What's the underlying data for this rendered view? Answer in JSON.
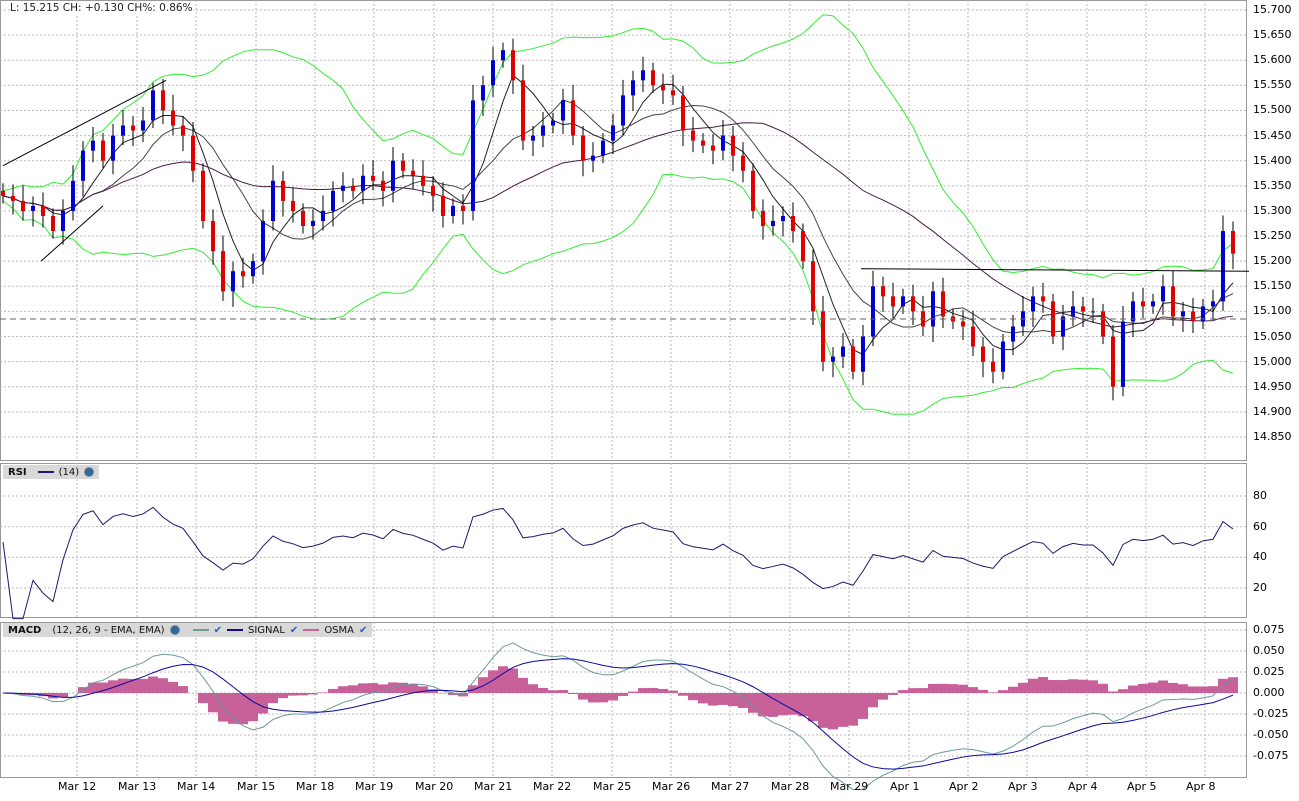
{
  "header": {
    "text": "L: 15.215 CH: +0.130 CH%: 0.86%"
  },
  "rsi_legend": {
    "name": "RSI",
    "params": "(14)"
  },
  "macd_legend": {
    "name": "MACD",
    "params": "(12, 26, 9 - EMA, EMA)",
    "signal": "SIGNAL",
    "osma": "OSMA"
  },
  "colors": {
    "up": "#0000d0",
    "down": "#e00000",
    "bollinger": "#33ee33",
    "rsi": "#1a1a6e",
    "macd": "#6a9a9a",
    "signal": "#0a0aa0",
    "osma": "#c8609a"
  },
  "chart_data": [
    {
      "type": "candlestick",
      "title": "Price",
      "ylim": [
        14.82,
        15.72
      ],
      "y_ticks": [
        "15.700",
        "15.650",
        "15.600",
        "15.550",
        "15.500",
        "15.450",
        "15.400",
        "15.350",
        "15.300",
        "15.250",
        "15.200",
        "15.150",
        "15.100",
        "15.050",
        "15.000",
        "14.950",
        "14.900",
        "14.850"
      ],
      "x_ticks": [
        {
          "label": "Mar 12",
          "pos": 7.4
        },
        {
          "label": "Mar 13",
          "pos": 13.4
        },
        {
          "label": "Mar 14",
          "pos": 19.3
        },
        {
          "label": "Mar 15",
          "pos": 25.3
        },
        {
          "label": "Mar 18",
          "pos": 31.2
        },
        {
          "label": "Mar 19",
          "pos": 37.1
        },
        {
          "label": "Mar 20",
          "pos": 43.1
        },
        {
          "label": "Mar 21",
          "pos": 49.0
        },
        {
          "label": "Mar 22",
          "pos": 54.9
        },
        {
          "label": "Mar 25",
          "pos": 60.9
        },
        {
          "label": "Mar 26",
          "pos": 66.8
        },
        {
          "label": "Mar 27",
          "pos": 72.7
        },
        {
          "label": "Mar 28",
          "pos": 78.7
        },
        {
          "label": "Mar 29",
          "pos": 84.6
        },
        {
          "label": "Apr 1",
          "pos": 90.6
        },
        {
          "label": "Apr 2",
          "pos": 96.5
        },
        {
          "label": "Apr 3",
          "pos": 102.4
        },
        {
          "label": "Apr 4",
          "pos": 108.4
        },
        {
          "label": "Apr 5",
          "pos": 114.3
        },
        {
          "label": "Apr 8",
          "pos": 120.2
        }
      ],
      "closes": [
        15.33,
        15.32,
        15.3,
        15.31,
        15.29,
        15.26,
        15.3,
        15.36,
        15.42,
        15.44,
        15.4,
        15.45,
        15.47,
        15.46,
        15.48,
        15.54,
        15.5,
        15.47,
        15.45,
        15.38,
        15.28,
        15.22,
        15.14,
        15.18,
        15.17,
        15.2,
        15.28,
        15.36,
        15.32,
        15.3,
        15.27,
        15.28,
        15.3,
        15.34,
        15.35,
        15.34,
        15.37,
        15.36,
        15.34,
        15.4,
        15.38,
        15.37,
        15.35,
        15.33,
        15.29,
        15.31,
        15.3,
        15.52,
        15.55,
        15.6,
        15.62,
        15.56,
        15.44,
        15.45,
        15.47,
        15.48,
        15.52,
        15.45,
        15.4,
        15.41,
        15.44,
        15.47,
        15.53,
        15.56,
        15.58,
        15.55,
        15.54,
        15.53,
        15.46,
        15.44,
        15.43,
        15.42,
        15.45,
        15.41,
        15.38,
        15.3,
        15.27,
        15.28,
        15.29,
        15.26,
        15.2,
        15.1,
        15.0,
        15.01,
        15.03,
        14.98,
        15.05,
        15.15,
        15.13,
        15.11,
        15.13,
        15.1,
        15.07,
        15.14,
        15.09,
        15.08,
        15.07,
        15.03,
        15.0,
        14.98,
        15.04,
        15.07,
        15.1,
        15.13,
        15.12,
        15.05,
        15.09,
        15.11,
        15.1,
        15.1,
        15.05,
        14.95,
        15.08,
        15.12,
        15.11,
        15.12,
        15.15,
        15.09,
        15.1,
        15.08,
        15.11,
        15.12,
        15.26,
        15.215
      ],
      "overlays": [
        "Bollinger(20,2)",
        "SMA(5)",
        "SMA(10)",
        "SMA(30)"
      ],
      "lines": [
        {
          "kind": "trend",
          "from": [
            0,
            15.39
          ],
          "to": [
            16.3,
            15.56
          ]
        },
        {
          "kind": "trend",
          "from": [
            3.8,
            15.2
          ],
          "to": [
            10,
            15.31
          ]
        },
        {
          "kind": "horizontal",
          "from": [
            85.8,
            15.185
          ],
          "to": [
            124.6,
            15.18
          ]
        },
        {
          "kind": "dashed",
          "value": 15.085
        }
      ]
    },
    {
      "type": "line",
      "title": "RSI",
      "ylim": [
        10,
        90
      ],
      "y_ticks": [
        "80",
        "60",
        "40",
        "20"
      ]
    },
    {
      "type": "line+histogram",
      "title": "MACD",
      "ylim": [
        -0.09,
        0.082
      ],
      "y_ticks": [
        "0.075",
        "0.050",
        "0.025",
        "0.000",
        "-0.025",
        "-0.050",
        "-0.075"
      ]
    }
  ]
}
